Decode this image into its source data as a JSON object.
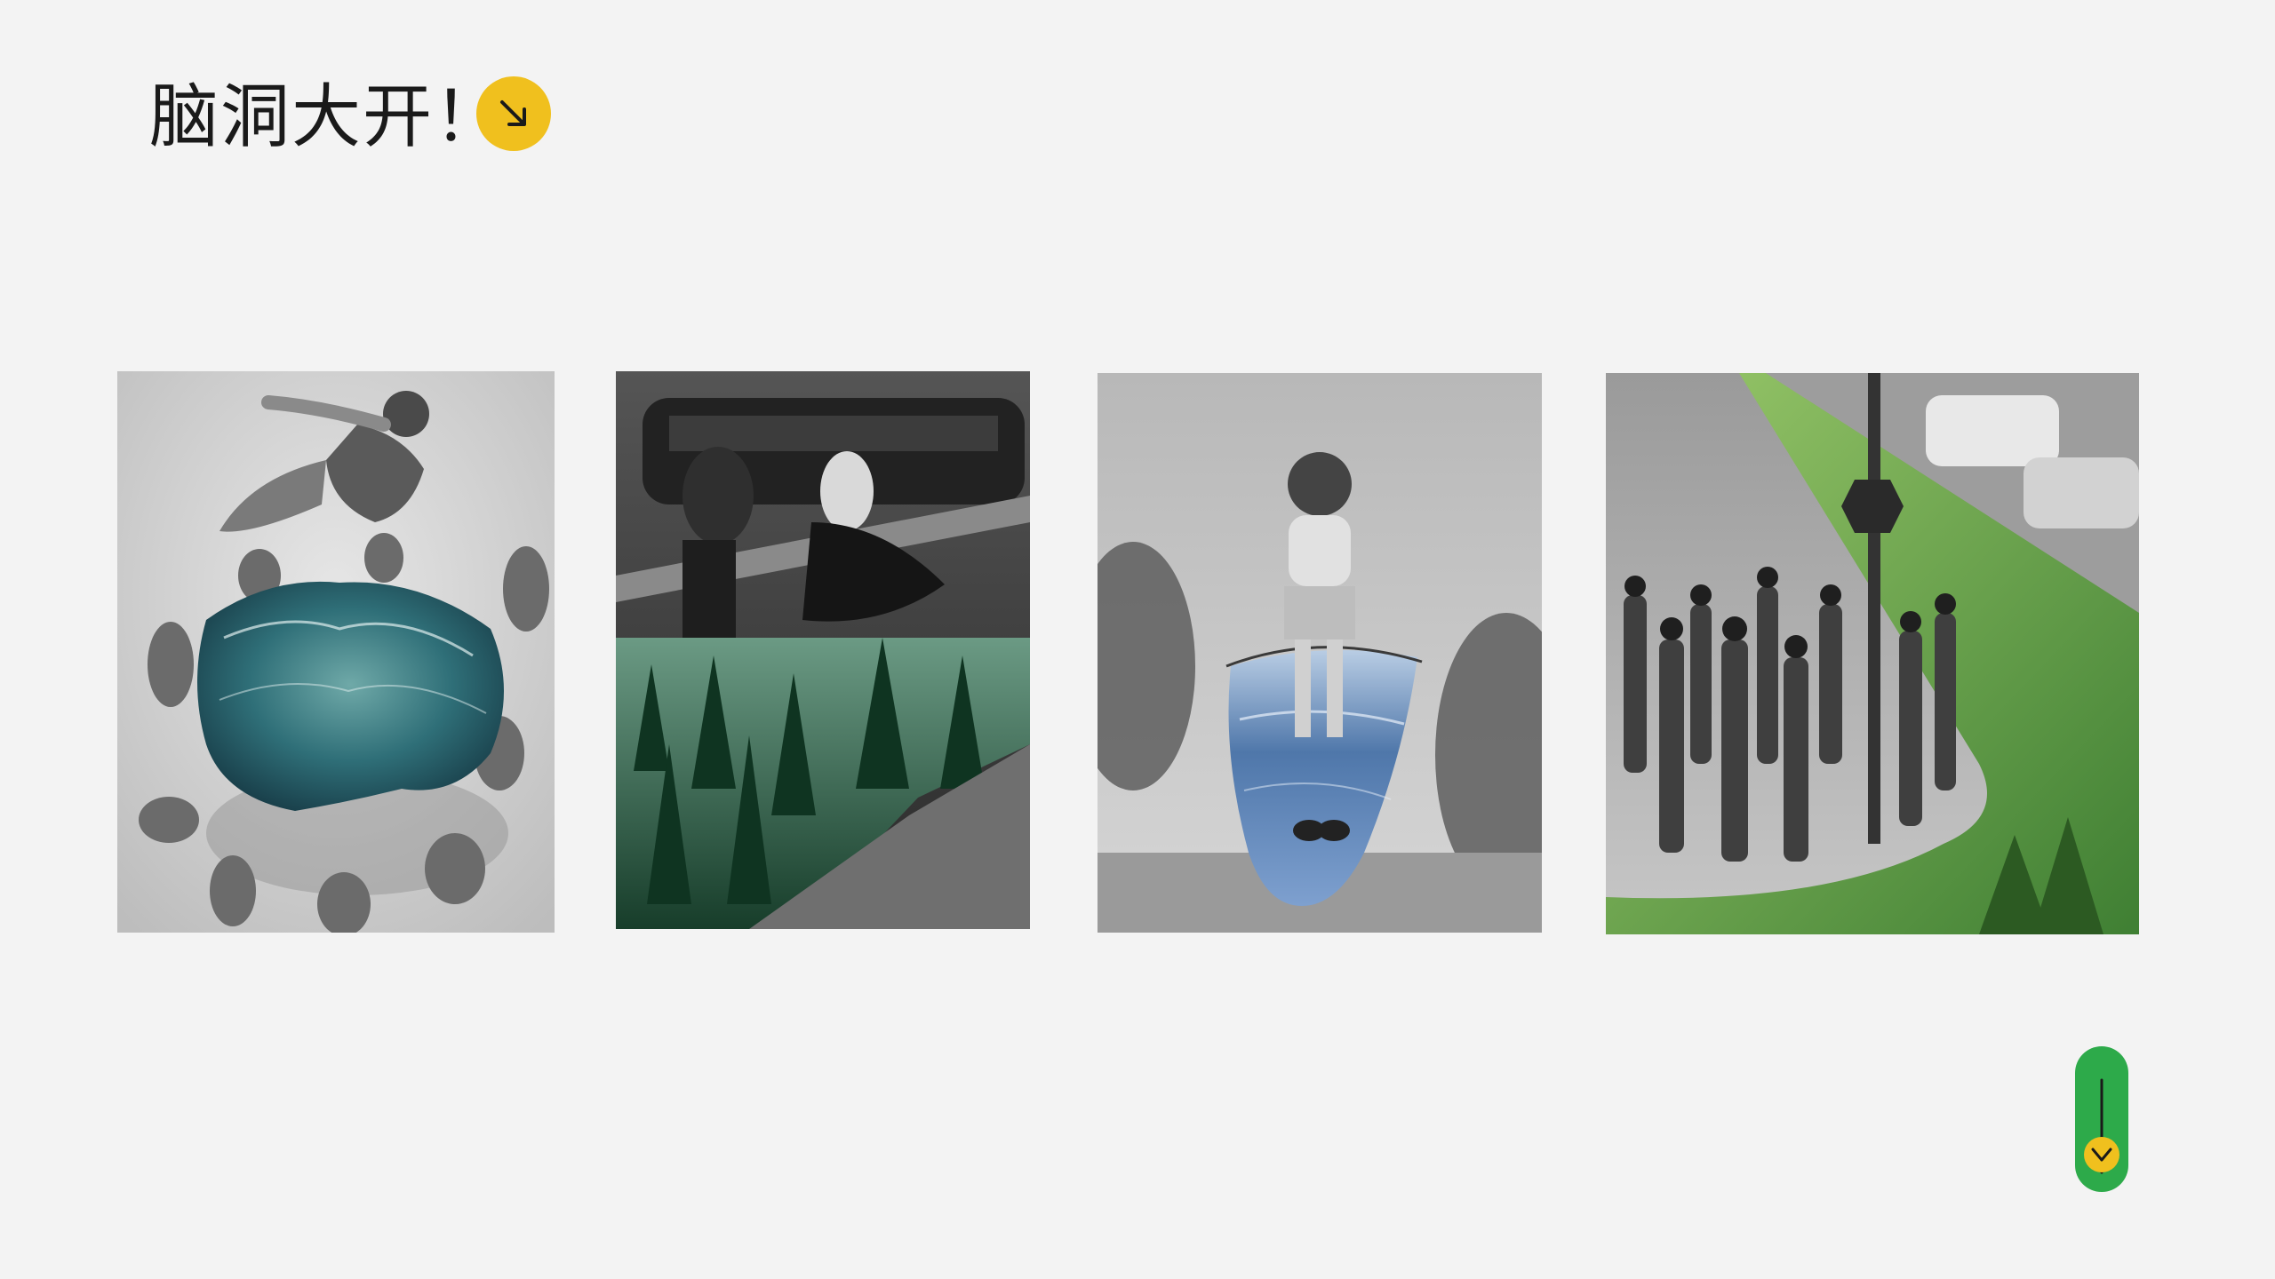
{
  "slide": {
    "title": "脑洞大开！",
    "badge_icon": "arrow-down-right-icon",
    "accent_yellow": "#f0c01e",
    "accent_green": "#2daa4a"
  },
  "gallery": {
    "cards": [
      {
        "name": "collage-beach-ocean",
        "icon": "photo-icon"
      },
      {
        "name": "collage-street-forest",
        "icon": "photo-icon"
      },
      {
        "name": "collage-jumprope-sea",
        "icon": "photo-icon"
      },
      {
        "name": "collage-sidewalk-hills",
        "icon": "photo-icon"
      }
    ]
  },
  "scroll_indicator": {
    "icon": "arrow-down-icon"
  }
}
